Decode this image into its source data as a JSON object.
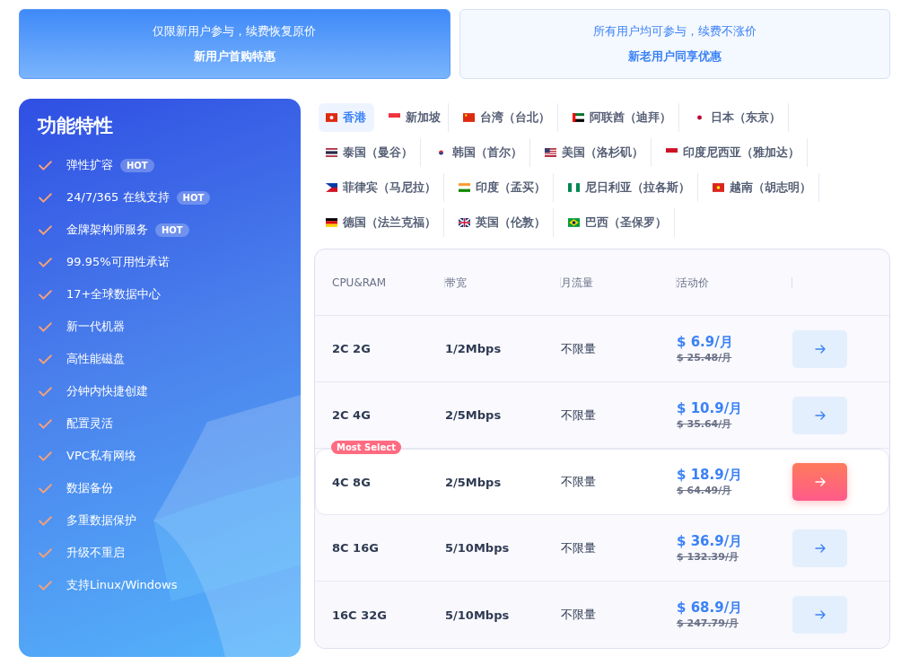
{
  "promos": [
    {
      "subtitle": "仅限新用户参与，续费恢复原价",
      "title": "新用户首购特惠",
      "selected": true
    },
    {
      "subtitle": "所有用户均可参与，续费不涨价",
      "title": "新老用户同享优惠",
      "selected": false
    }
  ],
  "features": {
    "title": "功能特性",
    "items": [
      {
        "label": "弹性扩容",
        "tag": "HOT"
      },
      {
        "label": "24/7/365 在线支持",
        "tag": "HOT"
      },
      {
        "label": "金牌架构师服务",
        "tag": "HOT"
      },
      {
        "label": "99.95%可用性承诺"
      },
      {
        "label": "17+全球数据中心"
      },
      {
        "label": "新一代机器"
      },
      {
        "label": "高性能磁盘"
      },
      {
        "label": "分钟内快捷创建"
      },
      {
        "label": "配置灵活"
      },
      {
        "label": "VPC私有网络"
      },
      {
        "label": "数据备份"
      },
      {
        "label": "多重数据保护"
      },
      {
        "label": "升级不重启"
      },
      {
        "label": "支持Linux/Windows"
      }
    ]
  },
  "regions": [
    {
      "label": "香港",
      "selected": true
    },
    {
      "label": "新加坡",
      "selected": false
    },
    {
      "label": "台湾（台北）",
      "selected": false
    },
    {
      "label": "阿联酋（迪拜）",
      "selected": false
    },
    {
      "label": "日本（东京）",
      "selected": false
    },
    {
      "label": "泰国（曼谷）",
      "selected": false
    },
    {
      "label": "韩国（首尔）",
      "selected": false
    },
    {
      "label": "美国（洛杉矶）",
      "selected": false
    },
    {
      "label": "印度尼西亚（雅加达）",
      "selected": false
    },
    {
      "label": "菲律宾（马尼拉）",
      "selected": false
    },
    {
      "label": "印度（孟买）",
      "selected": false
    },
    {
      "label": "尼日利亚（拉各斯）",
      "selected": false
    },
    {
      "label": "越南（胡志明）",
      "selected": false
    },
    {
      "label": "德国（法兰克福）",
      "selected": false
    },
    {
      "label": "英国（伦敦）",
      "selected": false
    },
    {
      "label": "巴西（圣保罗）",
      "selected": false
    }
  ],
  "table": {
    "columns": [
      "CPU&RAM",
      "带宽",
      "月流量",
      "活动价"
    ],
    "rows": [
      {
        "spec": "2C 2G",
        "bandwidth": "1/2Mbps",
        "traffic": "不限量",
        "price": "$ 6.9/月",
        "original_price": "$ 25.48/月",
        "highlighted": false
      },
      {
        "spec": "2C 4G",
        "bandwidth": "2/5Mbps",
        "traffic": "不限量",
        "price": "$ 10.9/月",
        "original_price": "$ 35.64/月",
        "highlighted": false
      },
      {
        "spec": "4C 8G",
        "bandwidth": "2/5Mbps",
        "traffic": "不限量",
        "price": "$ 18.9/月",
        "original_price": "$ 64.49/月",
        "highlighted": true,
        "badge": "Most Select"
      },
      {
        "spec": "8C 16G",
        "bandwidth": "5/10Mbps",
        "traffic": "不限量",
        "price": "$ 36.9/月",
        "original_price": "$ 132.39/月",
        "highlighted": false
      },
      {
        "spec": "16C 32G",
        "bandwidth": "5/10Mbps",
        "traffic": "不限量",
        "price": "$ 68.9/月",
        "original_price": "$ 247.79/月",
        "highlighted": false
      }
    ]
  }
}
